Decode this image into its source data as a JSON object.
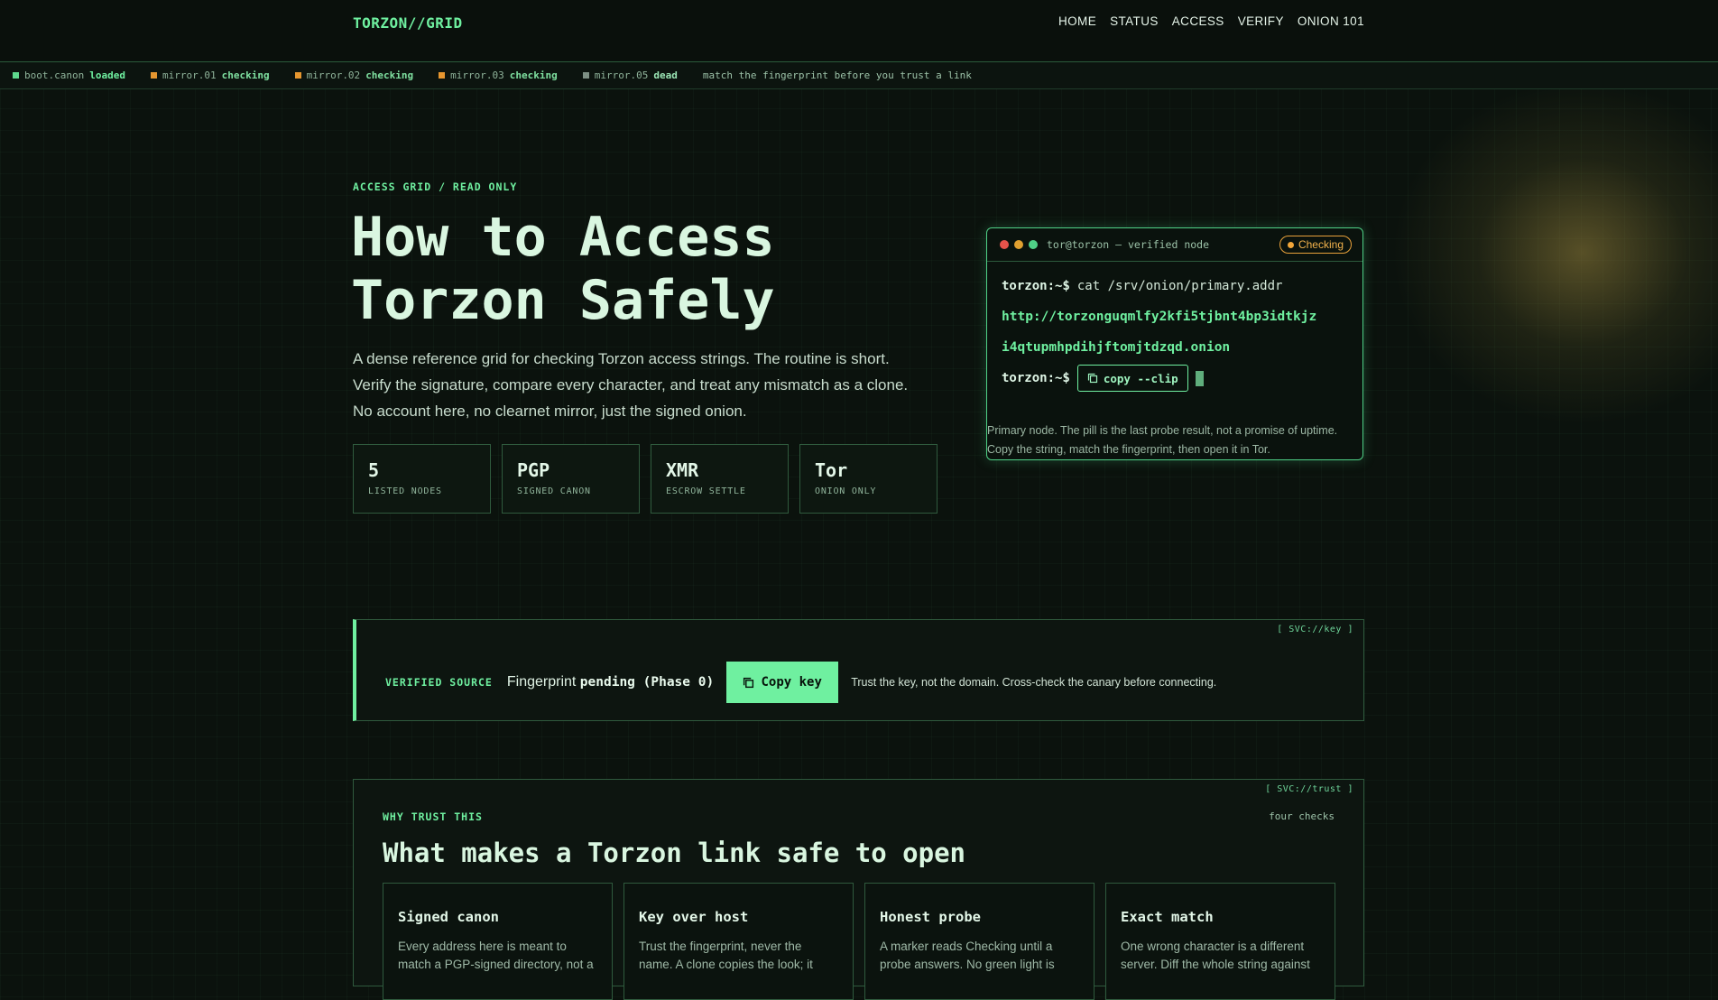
{
  "header": {
    "brand": "TORZON//GRID",
    "nav": [
      "HOME",
      "STATUS",
      "ACCESS",
      "VERIFY",
      "ONION 101"
    ]
  },
  "status_strip": {
    "items": [
      {
        "name": "boot.canon",
        "state": "loaded",
        "color": "#5fd98e"
      },
      {
        "name": "mirror.01",
        "state": "checking",
        "color": "#e6962f"
      },
      {
        "name": "mirror.02",
        "state": "checking",
        "color": "#e6962f"
      },
      {
        "name": "mirror.03",
        "state": "checking",
        "color": "#e6962f"
      },
      {
        "name": "mirror.05",
        "state": "dead",
        "color": "#7d8f84"
      }
    ],
    "message": "match the fingerprint before you trust a link"
  },
  "hero": {
    "eyebrow": "ACCESS GRID / READ ONLY",
    "title_line1": "How to Access",
    "title_line2": "Torzon Safely",
    "description": "A dense reference grid for checking Torzon access strings. The routine is short. Verify the signature, compare every character, and treat any mismatch as a clone. No account here, no clearnet mirror, just the signed onion.",
    "stats": [
      {
        "value": "5",
        "label": "LISTED NODES"
      },
      {
        "value": "PGP",
        "label": "SIGNED CANON"
      },
      {
        "value": "XMR",
        "label": "ESCROW SETTLE"
      },
      {
        "value": "Tor",
        "label": "ONION ONLY"
      }
    ]
  },
  "terminal": {
    "title": "tor@torzon — verified node",
    "status_pill": "Checking",
    "prompt": "torzon:~$",
    "command": "cat /srv/onion/primary.addr",
    "address_line1": "http://torzonguqmlfy2kfi5tjbnt4bp3idtkjz",
    "address_line2": "i4qtupmhpdihjftomjtdzqd.onion",
    "copy_label": "copy --clip",
    "footnote": "Primary node. The pill is the last probe result, not a promise of uptime. Copy the string, match the fingerprint, then open it in Tor."
  },
  "verified_source": {
    "tag": "[ SVC://key ]",
    "label": "VERIFIED SOURCE",
    "fingerprint_prefix": "Fingerprint",
    "fingerprint_status": "pending (Phase 0)",
    "copy_button": "Copy key",
    "note": "Trust the key, not the domain. Cross-check the canary before connecting."
  },
  "trust": {
    "tag": "[ SVC://trust ]",
    "eyebrow": "WHY TRUST THIS",
    "count": "four checks",
    "title": "What makes a Torzon link safe to open",
    "cards": [
      {
        "title": "Signed canon",
        "text": "Every address here is meant to match a PGP-signed directory, not a"
      },
      {
        "title": "Key over host",
        "text": "Trust the fingerprint, never the name. A clone copies the look; it"
      },
      {
        "title": "Honest probe",
        "text": "A marker reads Checking until a probe answers. No green light is"
      },
      {
        "title": "Exact match",
        "text": "One wrong character is a different server. Diff the whole string against"
      }
    ]
  },
  "colors": {
    "accent": "#6ff0a0",
    "background": "#0b120d",
    "warning": "#f2a63a"
  }
}
